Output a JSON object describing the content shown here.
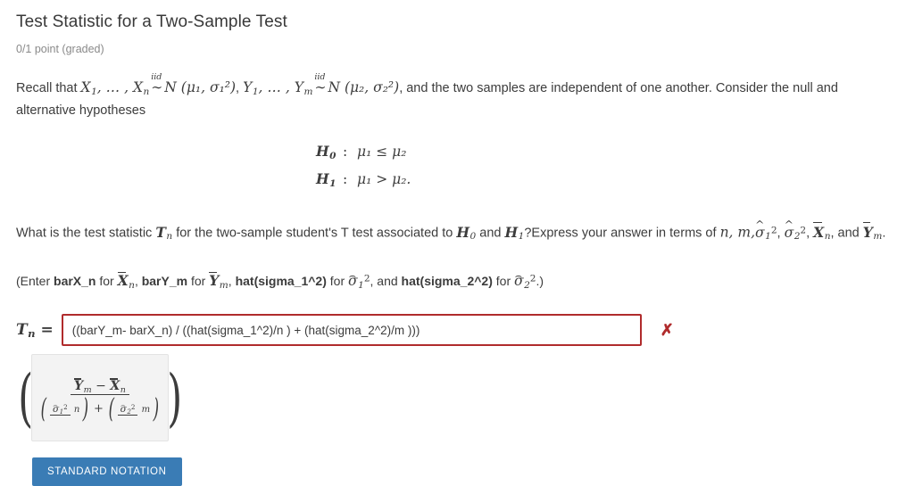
{
  "problem": {
    "title": "Test Statistic for a Two-Sample Test",
    "points_status": "0/1 point (graded)"
  },
  "prompt": {
    "lead": "Recall that",
    "x_sample_start": "X",
    "x_sample_start_sub": "1",
    "ellipsis": ", … ,",
    "x_sample_end": "X",
    "x_sample_end_sub": "n",
    "iid_label": "iid",
    "tilde": "∼",
    "normal_symbol": "N",
    "dist1": "(μ₁, σ₁²)",
    "y_sample_start": "Y",
    "y_sample_start_sub": "1",
    "y_sample_end": "Y",
    "y_sample_end_sub": "m",
    "dist2": "(μ₂, σ₂²)",
    "tail": ", and the two samples are independent of one another. Consider the null and alternative hypotheses"
  },
  "hypotheses": [
    {
      "name": "H",
      "name_sub": "0",
      "colon": ":",
      "body": "μ₁ ≤ μ₂"
    },
    {
      "name": "H",
      "name_sub": "1",
      "colon": ":",
      "body": "μ₁ > μ₂."
    }
  ],
  "question": {
    "part1": "What is the test statistic",
    "statistic": "T",
    "statistic_sub": "n",
    "part2": "for the two-sample student's T test associated to",
    "h0": "H",
    "h0_sub": "0",
    "and": "and",
    "h1": "H",
    "h1_sub": "1",
    "part3": "?Express your answer in terms of",
    "terms_plain": "n, m,",
    "sigma1": "σ",
    "sigma1_sub": "1",
    "sigma1_sup": "2",
    "sigma2": "σ",
    "sigma2_sub": "2",
    "sigma2_sup": "2",
    "xbar": "X",
    "xbar_sub": "n",
    "comma": ",",
    "part4": "and",
    "ybar": "Y",
    "ybar_sub": "m",
    "period": "."
  },
  "enter_note": {
    "open_paren": "(Enter",
    "token_barx": "barX_n",
    "for1": "for",
    "xbar": "X",
    "xbar_sub": "n",
    "comma1": ",",
    "token_bary": "barY_m",
    "for2": "for",
    "ybar": "Y",
    "ybar_sub": "m",
    "comma2": ",",
    "token_hat1": "hat(sigma_1^2)",
    "for3": "for",
    "sigma1": "σ",
    "sigma1_sub": "1",
    "sigma1_sup": "2",
    "comma3": ", and",
    "token_hat2": "hat(sigma_2^2)",
    "for4": "for",
    "sigma2": "σ",
    "sigma2_sub": "2",
    "sigma2_sup": "2",
    "close_paren": ".)"
  },
  "answer": {
    "label": "T",
    "label_sub": "n",
    "equals": "=",
    "value": "((barY_m- barX_n) / ((hat(sigma_1^2)/n ) + (hat(sigma_2^2)/m )))",
    "placeholder": "",
    "status_icon": "✗",
    "status_color": "#b02b2c",
    "border_color": "#b02b2c"
  },
  "preview": {
    "open_paren": "(",
    "close_paren": ")",
    "numerator": {
      "ybar": "Y",
      "ybar_sub": "m",
      "minus": "−",
      "xbar": "X",
      "xbar_sub": "n"
    },
    "denominator": {
      "left_open": "(",
      "left_num_sigma": "σ",
      "left_num_sub": "1",
      "left_num_sup": "2",
      "left_den": "n",
      "left_close": ")",
      "plus": "+",
      "right_open": "(",
      "right_num_sigma": "σ",
      "right_num_sub": "2",
      "right_num_sup": "2",
      "right_den": "m",
      "right_close": ")"
    }
  },
  "buttons": {
    "standard_notation": "STANDARD NOTATION",
    "standard_notation_color": "#3a7cb5"
  }
}
